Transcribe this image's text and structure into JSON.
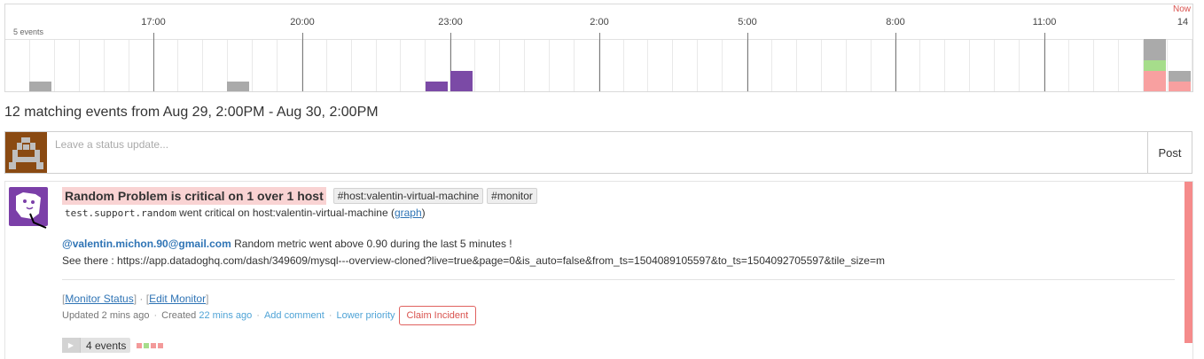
{
  "timeline": {
    "hours": [
      "17:00",
      "20:00",
      "23:00",
      "2:00",
      "5:00",
      "8:00",
      "11:00",
      "14"
    ],
    "now_label": "Now",
    "y_label": "5 events",
    "colors": {
      "gray": "#aaaaaa",
      "purple": "#7b4aa6",
      "green": "#a6dd8b",
      "red": "#f8a0a0"
    }
  },
  "summary": "12 matching events from Aug 29, 2:00PM - Aug 30, 2:00PM",
  "status": {
    "placeholder": "Leave a status update...",
    "post_label": "Post"
  },
  "event": {
    "title": "Random Problem is critical on 1 over 1 host",
    "tags": [
      "#host:valentin-virtual-machine",
      "#monitor"
    ],
    "desc_metric": "test.support.random",
    "desc_text": " went critical on host:valentin-virtual-machine (",
    "desc_link": "graph",
    "desc_close": ")",
    "mention": "@valentin.michon.90@gmail.com",
    "message": " Random metric went above 0.90 during the last 5 minutes !",
    "see_there": "See there : https://app.datadoghq.com/dash/349609/mysql---overview-cloned?live=true&page=0&is_auto=false&from_ts=1504089105597&to_ts=1504092705597&tile_size=m",
    "monitor_status": "Monitor Status",
    "edit_monitor": "Edit Monitor",
    "updated": "Updated 2 mins ago",
    "created_label": "Created",
    "created_value": "22 mins ago",
    "add_comment": "Add comment",
    "lower_priority": "Lower priority",
    "claim": "Claim Incident",
    "events_count": "4 events"
  }
}
